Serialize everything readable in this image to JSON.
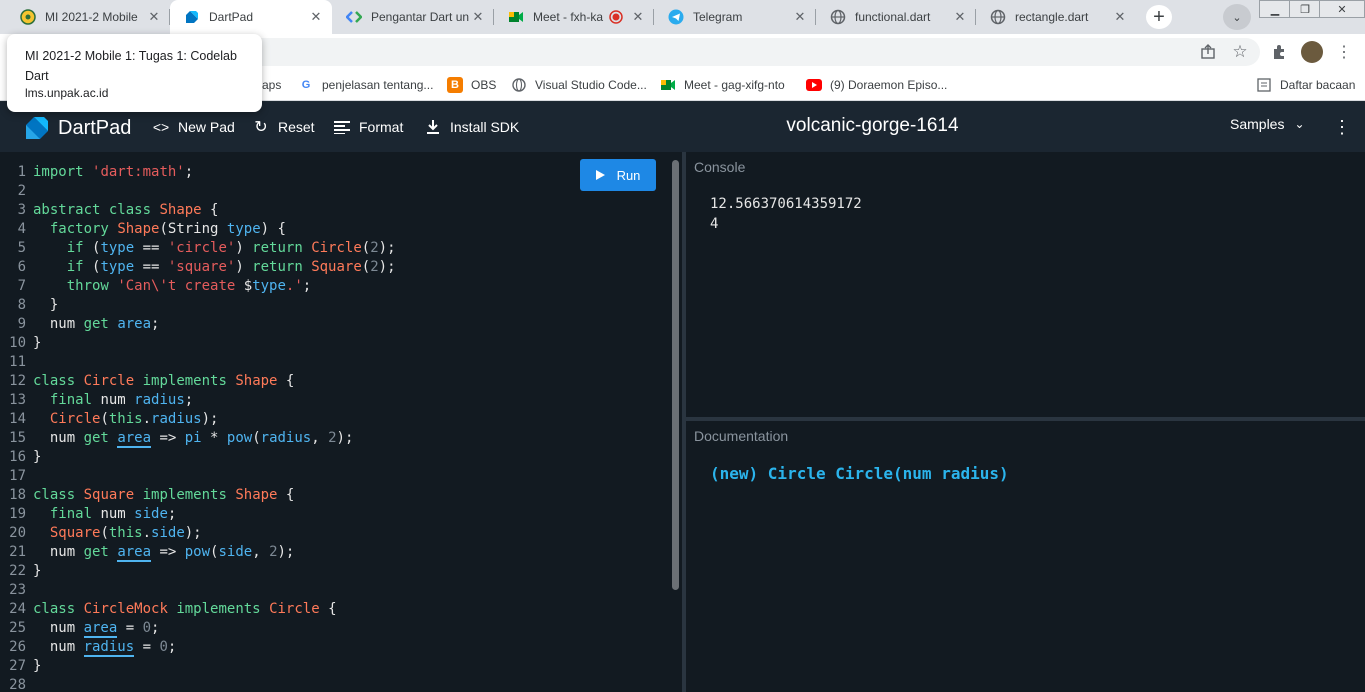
{
  "browser": {
    "tabs": [
      {
        "title": "MI 2021-2 Mobile",
        "icon": "unpak-logo-icon"
      },
      {
        "title": "DartPad",
        "icon": "dart-logo-icon"
      },
      {
        "title": "Pengantar Dart un",
        "icon": "codelab-icon"
      },
      {
        "title": "Meet - fxh-ka",
        "icon": "google-meet-icon"
      },
      {
        "title": "Telegram",
        "icon": "telegram-icon"
      },
      {
        "title": "functional.dart",
        "icon": "globe-icon"
      },
      {
        "title": "rectangle.dart",
        "icon": "globe-icon"
      }
    ],
    "new_tab": "+",
    "tooltip": {
      "title": "MI 2021-2 Mobile 1: Tugas 1: Codelab Dart",
      "url": "lms.unpak.ac.id"
    },
    "bookmarks": [
      {
        "label": "aps",
        "icon": "apps-icon"
      },
      {
        "label": "penjelasan tentang...",
        "icon": "google-icon"
      },
      {
        "label": "OBS",
        "icon": "blogger-icon"
      },
      {
        "label": "Visual Studio Code...",
        "icon": "globe-icon"
      },
      {
        "label": "Meet - gag-xifg-nto",
        "icon": "google-meet-icon"
      },
      {
        "label": "(9) Doraemon Episo...",
        "icon": "youtube-icon"
      }
    ],
    "reading_list": "Daftar bacaan"
  },
  "dartpad": {
    "logo": "DartPad",
    "new_pad": "New Pad",
    "reset": "Reset",
    "format": "Format",
    "install_sdk": "Install SDK",
    "pad_title": "volcanic-gorge-1614",
    "samples": "Samples",
    "run": "Run",
    "console_title": "Console",
    "console_lines": [
      "12.566370614359172",
      "4"
    ],
    "docs_title": "Documentation",
    "docs_text": "(new) Circle Circle(num radius)",
    "code_lines": [
      "import 'dart:math';",
      "",
      "abstract class Shape {",
      "  factory Shape(String type) {",
      "    if (type == 'circle') return Circle(2);",
      "    if (type == 'square') return Square(2);",
      "    throw 'Can\\'t create $type.';",
      "  }",
      "  num get area;",
      "}",
      "",
      "class Circle implements Shape {",
      "  final num radius;",
      "  Circle(this.radius);",
      "  num get area => pi * pow(radius, 2);",
      "}",
      "",
      "class Square implements Shape {",
      "  final num side;",
      "  Square(this.side);",
      "  num get area => pow(side, 2);",
      "}",
      "",
      "class CircleMock implements Circle {",
      "  num area = 0;",
      "  num radius = 0;",
      "}",
      ""
    ],
    "colors": {
      "keyword": "#63d99a",
      "type": "#ff7a59",
      "string": "#e55c5c",
      "identifier": "#4fb4f0",
      "run_button": "#1e88e5"
    }
  }
}
